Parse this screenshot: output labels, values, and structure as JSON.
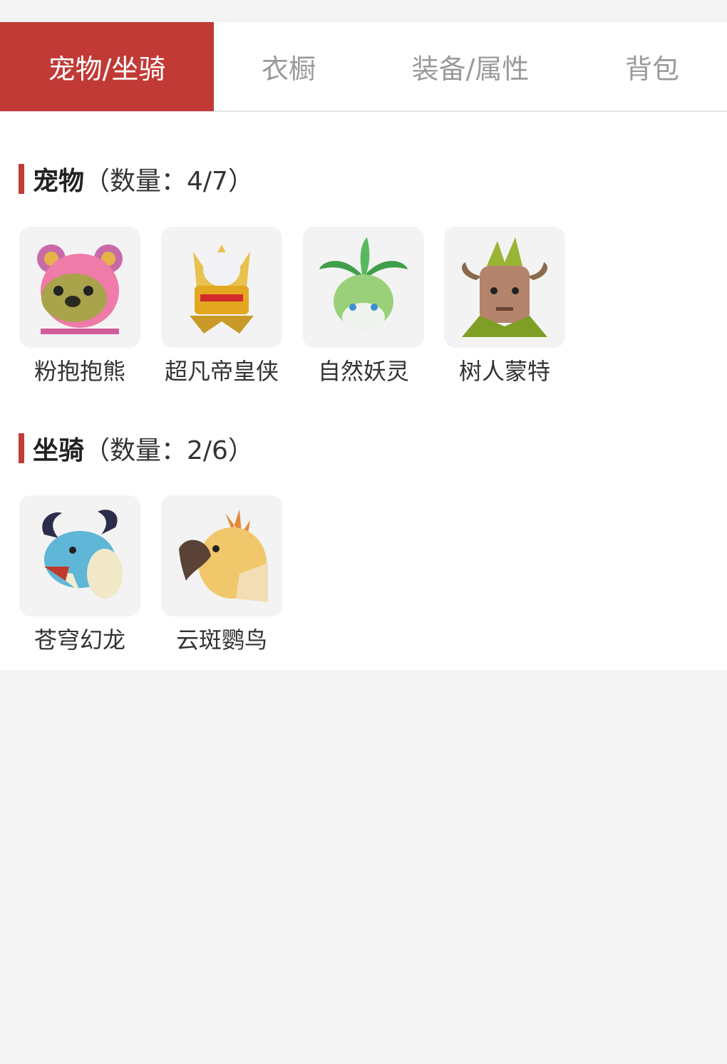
{
  "tabs": [
    {
      "label": "宠物/坐骑",
      "active": true
    },
    {
      "label": "衣橱",
      "active": false
    },
    {
      "label": "装备/属性",
      "active": false
    },
    {
      "label": "背包",
      "active": false
    }
  ],
  "pets": {
    "title": "宠物",
    "count_text": "（数量：4/7）",
    "items": [
      {
        "name": "粉抱抱熊",
        "icon": "pink-bear-icon"
      },
      {
        "name": "超凡帝皇侠",
        "icon": "golden-armor-hero-icon"
      },
      {
        "name": "自然妖灵",
        "icon": "nature-sprite-icon"
      },
      {
        "name": "树人蒙特",
        "icon": "treant-icon"
      }
    ]
  },
  "mounts": {
    "title": "坐骑",
    "count_text": "（数量：2/6）",
    "items": [
      {
        "name": "苍穹幻龙",
        "icon": "sky-dragon-icon"
      },
      {
        "name": "云斑鹦鸟",
        "icon": "cloud-parrot-icon"
      }
    ]
  },
  "colors": {
    "accent": "#c13a36",
    "background": "#f4f4f4",
    "panel": "#ffffff",
    "tab_inactive_text": "#9a9a9a"
  }
}
